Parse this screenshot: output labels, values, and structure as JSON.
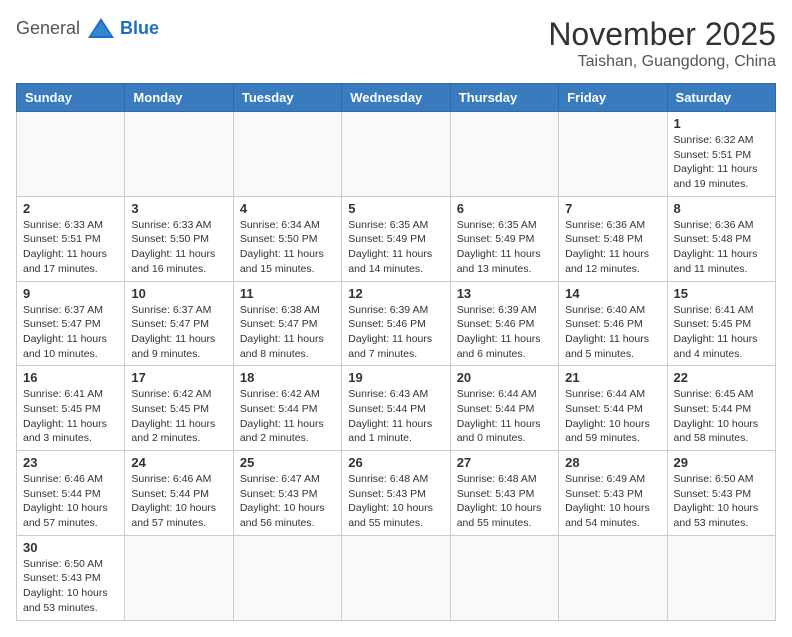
{
  "header": {
    "logo_general": "General",
    "logo_blue": "Blue",
    "month_title": "November 2025",
    "location": "Taishan, Guangdong, China"
  },
  "days_of_week": [
    "Sunday",
    "Monday",
    "Tuesday",
    "Wednesday",
    "Thursday",
    "Friday",
    "Saturday"
  ],
  "weeks": [
    [
      {
        "day": "",
        "info": ""
      },
      {
        "day": "",
        "info": ""
      },
      {
        "day": "",
        "info": ""
      },
      {
        "day": "",
        "info": ""
      },
      {
        "day": "",
        "info": ""
      },
      {
        "day": "",
        "info": ""
      },
      {
        "day": "1",
        "info": "Sunrise: 6:32 AM\nSunset: 5:51 PM\nDaylight: 11 hours and 19 minutes."
      }
    ],
    [
      {
        "day": "2",
        "info": "Sunrise: 6:33 AM\nSunset: 5:51 PM\nDaylight: 11 hours and 17 minutes."
      },
      {
        "day": "3",
        "info": "Sunrise: 6:33 AM\nSunset: 5:50 PM\nDaylight: 11 hours and 16 minutes."
      },
      {
        "day": "4",
        "info": "Sunrise: 6:34 AM\nSunset: 5:50 PM\nDaylight: 11 hours and 15 minutes."
      },
      {
        "day": "5",
        "info": "Sunrise: 6:35 AM\nSunset: 5:49 PM\nDaylight: 11 hours and 14 minutes."
      },
      {
        "day": "6",
        "info": "Sunrise: 6:35 AM\nSunset: 5:49 PM\nDaylight: 11 hours and 13 minutes."
      },
      {
        "day": "7",
        "info": "Sunrise: 6:36 AM\nSunset: 5:48 PM\nDaylight: 11 hours and 12 minutes."
      },
      {
        "day": "8",
        "info": "Sunrise: 6:36 AM\nSunset: 5:48 PM\nDaylight: 11 hours and 11 minutes."
      }
    ],
    [
      {
        "day": "9",
        "info": "Sunrise: 6:37 AM\nSunset: 5:47 PM\nDaylight: 11 hours and 10 minutes."
      },
      {
        "day": "10",
        "info": "Sunrise: 6:37 AM\nSunset: 5:47 PM\nDaylight: 11 hours and 9 minutes."
      },
      {
        "day": "11",
        "info": "Sunrise: 6:38 AM\nSunset: 5:47 PM\nDaylight: 11 hours and 8 minutes."
      },
      {
        "day": "12",
        "info": "Sunrise: 6:39 AM\nSunset: 5:46 PM\nDaylight: 11 hours and 7 minutes."
      },
      {
        "day": "13",
        "info": "Sunrise: 6:39 AM\nSunset: 5:46 PM\nDaylight: 11 hours and 6 minutes."
      },
      {
        "day": "14",
        "info": "Sunrise: 6:40 AM\nSunset: 5:46 PM\nDaylight: 11 hours and 5 minutes."
      },
      {
        "day": "15",
        "info": "Sunrise: 6:41 AM\nSunset: 5:45 PM\nDaylight: 11 hours and 4 minutes."
      }
    ],
    [
      {
        "day": "16",
        "info": "Sunrise: 6:41 AM\nSunset: 5:45 PM\nDaylight: 11 hours and 3 minutes."
      },
      {
        "day": "17",
        "info": "Sunrise: 6:42 AM\nSunset: 5:45 PM\nDaylight: 11 hours and 2 minutes."
      },
      {
        "day": "18",
        "info": "Sunrise: 6:42 AM\nSunset: 5:44 PM\nDaylight: 11 hours and 2 minutes."
      },
      {
        "day": "19",
        "info": "Sunrise: 6:43 AM\nSunset: 5:44 PM\nDaylight: 11 hours and 1 minute."
      },
      {
        "day": "20",
        "info": "Sunrise: 6:44 AM\nSunset: 5:44 PM\nDaylight: 11 hours and 0 minutes."
      },
      {
        "day": "21",
        "info": "Sunrise: 6:44 AM\nSunset: 5:44 PM\nDaylight: 10 hours and 59 minutes."
      },
      {
        "day": "22",
        "info": "Sunrise: 6:45 AM\nSunset: 5:44 PM\nDaylight: 10 hours and 58 minutes."
      }
    ],
    [
      {
        "day": "23",
        "info": "Sunrise: 6:46 AM\nSunset: 5:44 PM\nDaylight: 10 hours and 57 minutes."
      },
      {
        "day": "24",
        "info": "Sunrise: 6:46 AM\nSunset: 5:44 PM\nDaylight: 10 hours and 57 minutes."
      },
      {
        "day": "25",
        "info": "Sunrise: 6:47 AM\nSunset: 5:43 PM\nDaylight: 10 hours and 56 minutes."
      },
      {
        "day": "26",
        "info": "Sunrise: 6:48 AM\nSunset: 5:43 PM\nDaylight: 10 hours and 55 minutes."
      },
      {
        "day": "27",
        "info": "Sunrise: 6:48 AM\nSunset: 5:43 PM\nDaylight: 10 hours and 55 minutes."
      },
      {
        "day": "28",
        "info": "Sunrise: 6:49 AM\nSunset: 5:43 PM\nDaylight: 10 hours and 54 minutes."
      },
      {
        "day": "29",
        "info": "Sunrise: 6:50 AM\nSunset: 5:43 PM\nDaylight: 10 hours and 53 minutes."
      }
    ],
    [
      {
        "day": "30",
        "info": "Sunrise: 6:50 AM\nSunset: 5:43 PM\nDaylight: 10 hours and 53 minutes."
      },
      {
        "day": "",
        "info": ""
      },
      {
        "day": "",
        "info": ""
      },
      {
        "day": "",
        "info": ""
      },
      {
        "day": "",
        "info": ""
      },
      {
        "day": "",
        "info": ""
      },
      {
        "day": "",
        "info": ""
      }
    ]
  ]
}
